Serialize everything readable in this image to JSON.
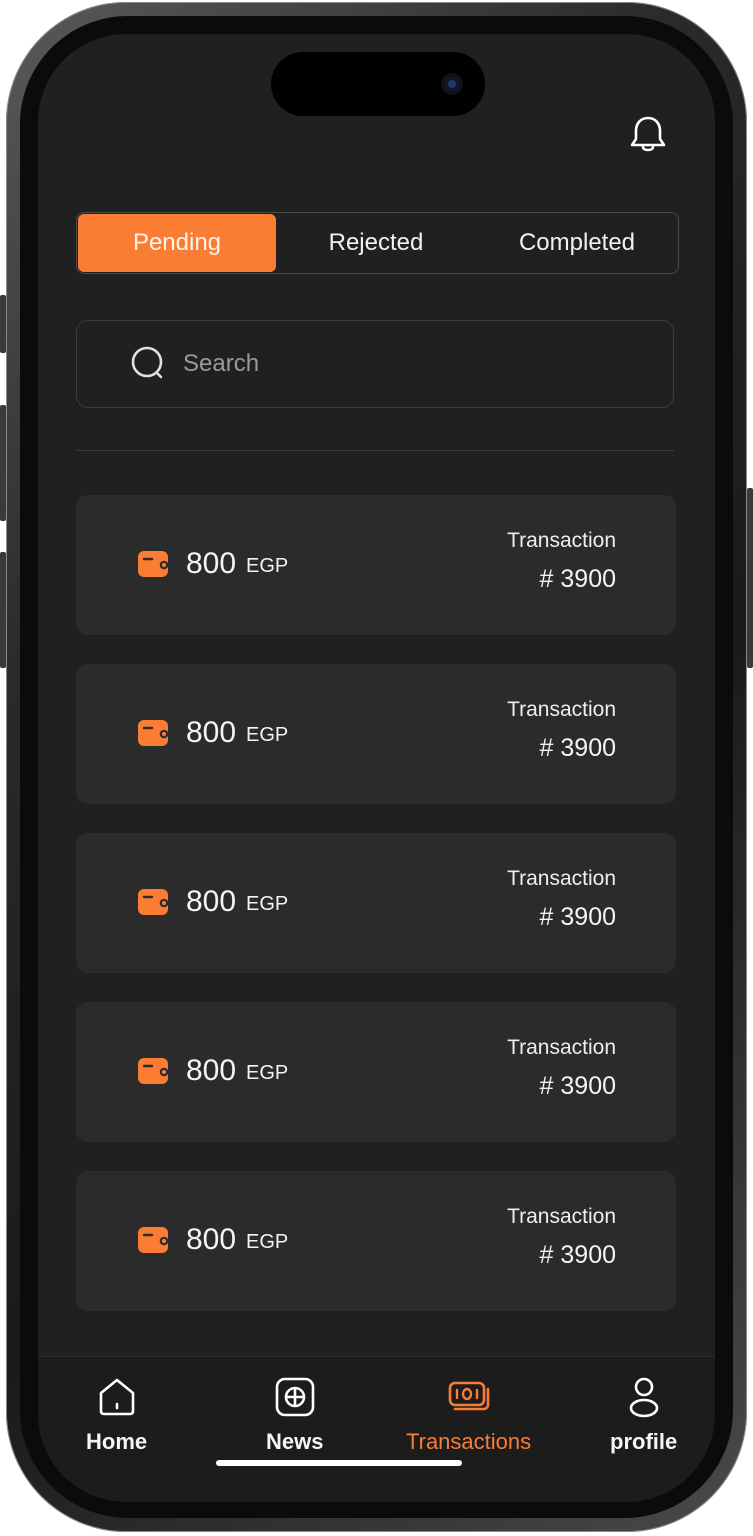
{
  "header": {
    "notification_icon": "bell-icon"
  },
  "tabs": [
    {
      "label": "Pending",
      "active": true
    },
    {
      "label": "Rejected",
      "active": false
    },
    {
      "label": "Completed",
      "active": false
    }
  ],
  "search": {
    "placeholder": "Search",
    "value": "",
    "icon": "search-icon"
  },
  "transactions": [
    {
      "amount": "800",
      "currency": "EGP",
      "label": "Transaction",
      "number": "# 3900"
    },
    {
      "amount": "800",
      "currency": "EGP",
      "label": "Transaction",
      "number": "# 3900"
    },
    {
      "amount": "800",
      "currency": "EGP",
      "label": "Transaction",
      "number": "# 3900"
    },
    {
      "amount": "800",
      "currency": "EGP",
      "label": "Transaction",
      "number": "# 3900"
    },
    {
      "amount": "800",
      "currency": "EGP",
      "label": "Transaction",
      "number": "# 3900"
    }
  ],
  "bottom_nav": [
    {
      "label": "Home",
      "icon": "home-icon",
      "active": false
    },
    {
      "label": "News",
      "icon": "news-icon",
      "active": false
    },
    {
      "label": "Transactions",
      "icon": "transactions-icon",
      "active": true
    },
    {
      "label": "profile",
      "icon": "profile-icon",
      "active": false
    }
  ],
  "colors": {
    "accent": "#fb7d33",
    "background": "#202020",
    "card": "#2b2b2b",
    "text": "#f4f4f4"
  }
}
